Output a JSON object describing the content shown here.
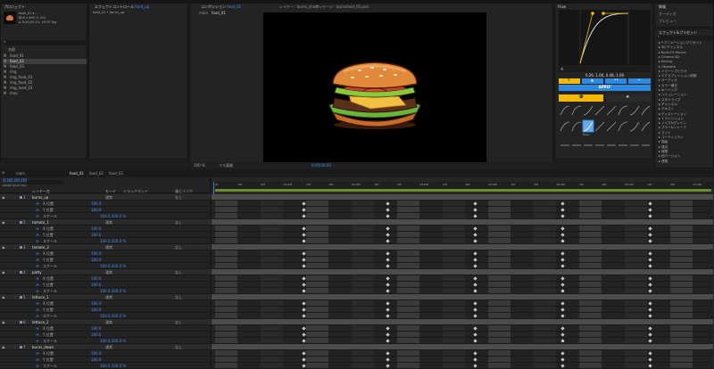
{
  "project": {
    "tab": "プロジェクト",
    "item_name": "food_01 ▾  ...",
    "item_info1": "800 x 800 (1.00)",
    "item_info2": "Δ 0;00;03;13, 29.97 fps",
    "search_placeholder": "",
    "col_name": "名前",
    "items": [
      "food_01",
      "food_02",
      "food_03",
      "img",
      "img_food_01",
      "img_food_02",
      "img_food_03",
      "mov"
    ]
  },
  "effects_controls": {
    "tab": "エフェクトコントロール",
    "tab_target": "food_up",
    "subtitle": "food_01 • burns_up"
  },
  "composition": {
    "tab": "コンポジション",
    "tab_target": "food_01",
    "other_tabs": [
      "レイヤー：burns_shoot",
      "フッテージ：burnsfood_01.psd"
    ],
    "breadcrumb": [
      "main",
      "food_01"
    ],
    "zoom": "100 %",
    "quality": "フル画質",
    "time": "0;00;00;00"
  },
  "flow": {
    "tab": "Flow",
    "values": "0.26, 1.00, 0.48, 1.00",
    "apply": "APPLY",
    "curve_label": "Basic"
  },
  "info": {
    "tabs": [
      "情報",
      "オーディオ",
      "プレビュー"
    ]
  },
  "effects_presets": {
    "tab": "エフェクト&プリセット",
    "items": [
      "* アニメーションプリセット",
      "3D チャンネル",
      "Boris FX Mocha",
      "Cinema 4D",
      "Keying",
      "Obsolete",
      "イマーシブビデオ",
      "エクスプレッション制御",
      "オーディオ",
      "カラー補正",
      "キーイング",
      "シミュレーション",
      "スタイライズ",
      "チャンネル",
      "テキスト",
      "ディストーション",
      "トランジション",
      "ノイズ&グレイン",
      "ブラー&シャープ",
      "マット",
      "ユーティリティ",
      "描画",
      "遠近",
      "時間",
      "旧バージョン",
      "透視"
    ]
  },
  "timeline": {
    "tabs": [
      "main",
      "food_01",
      "food_02",
      "food_03"
    ],
    "timecode": "0;00;00;00",
    "frame_info": "00000 (29.97 fps)",
    "headers": {
      "layer": "レイヤー名",
      "mode": "モード",
      "trk": "トラックマット",
      "parent": "親とリンク"
    },
    "ruler": [
      "0f",
      "10f",
      "20f",
      "01:00f",
      "10f",
      "20f",
      "02:00f",
      "10f",
      "20f",
      "03:00f",
      "10f",
      "20f",
      "04:00f",
      "10f",
      "20f",
      "05:00f",
      "10f",
      "20f",
      "06:00f",
      "10f",
      "20f",
      "07:00f"
    ],
    "layers": [
      {
        "num": "1",
        "name": "burns_up",
        "mode": "通常",
        "parent": "なし",
        "props": [
          "X 位置",
          "Y 位置",
          "スケール"
        ],
        "vals": [
          "180.0",
          "180.0",
          "100.0,100.0 %"
        ]
      },
      {
        "num": "2",
        "name": "tomato_1",
        "mode": "通常",
        "parent": "なし",
        "props": [
          "X 位置",
          "Y 位置",
          "スケール"
        ],
        "vals": [
          "180.0",
          "180.0",
          "100.0,100.0 %"
        ]
      },
      {
        "num": "3",
        "name": "tomato_2",
        "mode": "通常",
        "parent": "なし",
        "props": [
          "X 位置",
          "Y 位置",
          "スケール"
        ],
        "vals": [
          "180.0",
          "180.0",
          "100.0,100.0 %"
        ]
      },
      {
        "num": "4",
        "name": "patty",
        "mode": "通常",
        "parent": "なし",
        "props": [
          "X 位置",
          "Y 位置",
          "スケール"
        ],
        "vals": [
          "180.0",
          "180.0",
          "100.0,100.0 %"
        ]
      },
      {
        "num": "5",
        "name": "lettuce_1",
        "mode": "通常",
        "parent": "なし",
        "props": [
          "X 位置",
          "Y 位置",
          "スケール"
        ],
        "vals": [
          "180.0",
          "180.0",
          "100.0,100.0 %"
        ]
      },
      {
        "num": "6",
        "name": "lettuce_2",
        "mode": "通常",
        "parent": "なし",
        "props": [
          "X 位置",
          "Y 位置",
          "スケール"
        ],
        "vals": [
          "180.0",
          "180.0",
          "100.0,100.0 %"
        ]
      },
      {
        "num": "7",
        "name": "burns_down",
        "mode": "通常",
        "parent": "なし",
        "props": [
          "X 位置",
          "Y 位置",
          "スケール"
        ],
        "vals": [
          "180.0",
          "180.0",
          "100.0,100.0 %"
        ]
      }
    ]
  },
  "colors": {
    "accent": "#3a7bd5",
    "flow_yellow": "#f5b800",
    "flow_blue": "#2d8ae0",
    "bg": "#1d1d1d"
  }
}
